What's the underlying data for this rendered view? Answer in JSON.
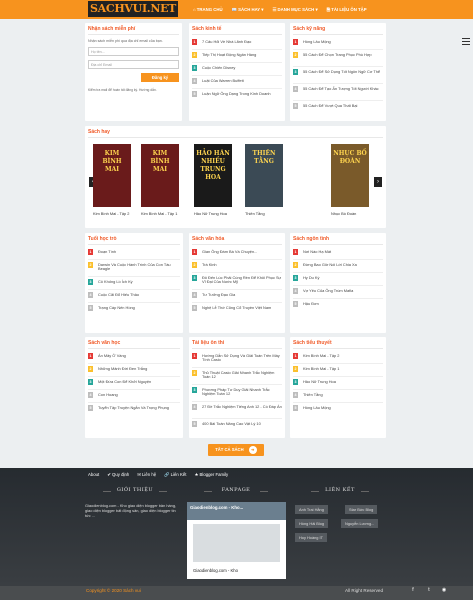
{
  "header": {
    "logo": "SACHVUI.NET",
    "nav": [
      "⌂ TRANG CHỦ",
      "📖 SÁCH HAY ▾",
      "☰ DANH MỤC SÁCH ▾",
      "🗎 TÀI LIỆU ÔN TẬP"
    ]
  },
  "subscribe": {
    "title": "Nhận sách miễn phí",
    "desc": "Nhận sách miễn phí qua địa chỉ email của bạn.",
    "name_placeholder": "Họ tên...",
    "email_placeholder": "Địa chỉ Email",
    "button": "Đăng ký",
    "note": "Kiểm tra mail để hoàn tất đăng ký. Hướng dẫn."
  },
  "kinhte": {
    "title": "Sách kinh tế",
    "items": [
      "7 Cấu Hỏi Về Nhà Lãnh Đạo",
      "Tiếp Thị Hoạt Động Ngân Hàng",
      "Cuộc Chiến Disney",
      "Luật Của Warren Buffett",
      "Luận Ngữ Ông Dạng Trong Kinh Doanh"
    ]
  },
  "kynang": {
    "title": "Sách kỹ năng",
    "items": [
      "Hồng Lâu Mộng",
      "55 Cách Để Chọn Trang Phục Phù Hợp",
      "55 Cách Để Sử Dụng Tốt Ngôn Ngữ Cơ Thể",
      "55 Cách Để Tạo Ấn Tượng Tốt Người Khác",
      "55 Cách Để Vượt Qua Thất Bại"
    ]
  },
  "sachhay": {
    "title": "Sách hay",
    "books": [
      {
        "cover": "KIM BÌNH MAI",
        "caption": "Kim Bình Mai - Tập 2"
      },
      {
        "cover": "KIM BÌNH MAI",
        "caption": "Kim Bình Mai - Tập 1"
      },
      {
        "cover": "HẢO HÁN NHIỀU TRUNG HOA",
        "caption": "Hảo Nữ Trung Hoa"
      },
      {
        "cover": "THIÊN TẰNG",
        "caption": "Thiên Tằng"
      },
      {
        "cover": "NHỤC BỒ ĐOÀN",
        "caption": "Nhục Bồ Đoàn"
      }
    ]
  },
  "tuoihoctro": {
    "title": "Tuổi học trò",
    "items": [
      "Đoạn Tình",
      "Darwin Và Cuộc Hành Trình Của Con Tàu Beagle",
      "Cô Khống Lồ Ích Kỷ",
      "Cuộc Cãi Đổ Hiếu Thảo",
      "Trạng Cáp Nến Hồng"
    ]
  },
  "vanhoa": {
    "title": "Sách văn hóa",
    "items": [
      "Gian Ông Đàm Bà Và Chuyện...",
      "Trà Kinh",
      "Đô Đến Lúc Phải Cúng Rèn Để Khôi Phục Sự Vĩ Đại Của Nước Mỹ",
      "Tư Tưởng Đạo Gia",
      "Nghệ Lễ Thờ Cũng Cổ Truyền Việt Nam"
    ]
  },
  "ngontinh": {
    "title": "Sách ngôn tình",
    "items": [
      "Nơi Nào Hạ Mát",
      "Đừng Bao Giờ Nói Lời Chia Xa",
      "Hy Du Ký",
      "Vợ Yêu Của Ông Trùm Mafia",
      "Hậu Đơn"
    ]
  },
  "vanhoc": {
    "title": "Sách văn học",
    "items": [
      "Án Mây Ở Vàng",
      "Những Mảnh Đời Đen Trắng",
      "Một Đứa Con Để Khởi Nguyện",
      "Con Hoang",
      "Tuyển Tập Truyện Ngắn Và Trọng Phụng"
    ]
  },
  "tailieuonthi": {
    "title": "Tài liệu ôn thi",
    "items": [
      "Hướng Dẫn Sử Dụng Và Giải Toán Trên Máy Tính Casio",
      "Thủ Thuật Casio Giải Nhanh Trắc Nghiệm Toán 12",
      "Phương Pháp Tư Duy Giải Nhanh Trắc Nghiệm Toán 12",
      "27 Đề Trắc Nghiệm Tiếng Anh 12 - Có Đáp Án",
      "400 Bài Toán Nâng Cao Vật Lý 10"
    ]
  },
  "tieuthuyet": {
    "title": "Sách tiểu thuyết",
    "items": [
      "Kim Bình Mai - Tập 2",
      "Kim Bình Mai - Tập 1",
      "Hảo Nữ Trung Hoa",
      "Thiên Tằng",
      "Hồng Lâu Mộng"
    ]
  },
  "all_button": "TẤT CẢ SÁCH",
  "footer": {
    "nav": [
      "About",
      "✔ Quy định",
      "✉ Liên hệ",
      "🔗 Liên Kết",
      "★ Blogger Family"
    ],
    "gioithieu_title": "GIỚI THIỆU",
    "gioithieu_text": "Giaodienblog.com - Kho giao diện blogger bản hàng, giao diện blogger bất động sản, giao diện blogger tin tức ...",
    "fanpage_title": "FANPAGE",
    "fanpage_name": "Giaodienblog.com - Kho...",
    "fanpage_name2": "Giaodienblog.com - Kho",
    "lienket_title": "LIÊN KẾT",
    "links": [
      "Anh Trai Hằng",
      "Star Bức Blog",
      "Hồng Hải Blog",
      "Nguyễn Lương...",
      "Hoy Hoàng IT"
    ],
    "copyright": "Copyright © 2020 Sách vui",
    "rights": "All Right Reserved"
  }
}
